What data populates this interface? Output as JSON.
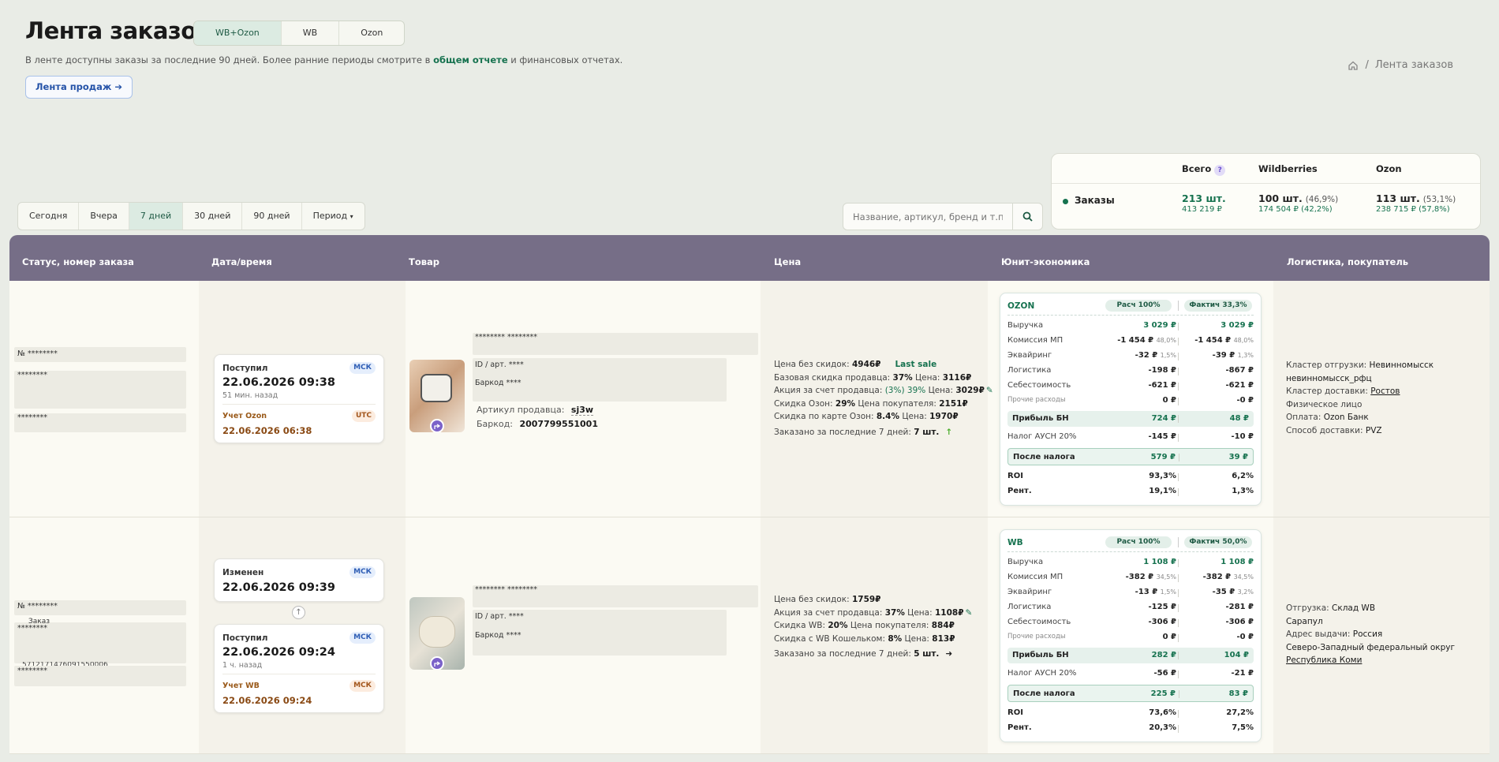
{
  "header": {
    "title": "Лента заказов",
    "seg": [
      "WB+Ozon",
      "WB",
      "Ozon"
    ],
    "sub_before": "В ленте доступны заказы за последние 90 дней. Более ранние периоды смотрите в ",
    "sub_link": "общем отчете",
    "sub_after": " и финансовых отчетах.",
    "sales_btn": "Лента продаж",
    "crumb_sep": "/",
    "crumb": "Лента заказов"
  },
  "summary": {
    "h_total": "Всего",
    "h_help": "?",
    "h_wb": "Wildberries",
    "h_ozon": "Ozon",
    "row": "Заказы",
    "total_cnt": "213 шт.",
    "total_sum": "413 219 ₽",
    "wb_cnt": "100 шт.",
    "wb_pct": "(46,9%)",
    "wb_sum": "174 504 ₽ (42,2%)",
    "ozon_cnt": "113 шт.",
    "ozon_pct": "(53,1%)",
    "ozon_sum": "238 715 ₽ (57,8%)"
  },
  "periods": [
    "Сегодня",
    "Вчера",
    "7 дней",
    "30 дней",
    "90 дней",
    "Период"
  ],
  "search": {
    "placeholder": "Название, артикул, бренд и т.п."
  },
  "columns": [
    "Статус, номер заказа",
    "Дата/время",
    "Товар",
    "Цена",
    "Юнит-экономика",
    "Логистика, покупатель"
  ],
  "orders": [
    {
      "num": "№ ********",
      "m1": "********",
      "m2": "********",
      "card1": {
        "label": "Поступил",
        "tz": "МСК",
        "date": "22.06.2026 09:38",
        "ago": "51 мин. назад",
        "acc_label": "Учет Ozon",
        "acc_tz": "UTC",
        "acc_date": "22.06.2026 06:38"
      },
      "prod": {
        "name": "******** ********",
        "id": "ID / арт. ****",
        "barcode": "Баркод ****",
        "seller_lbl": "Артикул продавца:",
        "seller_val": "sj3w",
        "bc_lbl": "Баркод:",
        "bc_val": "2007799551001"
      },
      "price": [
        [
          "Цена без скидок: ",
          "4946₽"
        ],
        [
          "Базовая скидка продавца: ",
          "37%",
          " Цена: ",
          "3116₽"
        ],
        [
          "Акция за счет продавца: ",
          "(3%) 39%",
          " Цена: ",
          "3029₽"
        ],
        [
          "Скидка Озон: ",
          "29%",
          " Цена покупателя: ",
          "2151₽"
        ],
        [
          "Скидка по карте Озон: ",
          "8.4%",
          " Цена: ",
          "1970₽"
        ],
        [
          "Заказано за последние 7 дней: ",
          "7 шт."
        ]
      ],
      "last_sale": "Last sale",
      "unit": {
        "mp": "OZON",
        "calc": "Расч 100%",
        "fact": "Фактич 33,3%",
        "rows": [
          [
            "Выручка",
            "3 029 ₽",
            "",
            "3 029 ₽",
            ""
          ],
          [
            "Комиссия МП",
            "-1 454 ₽",
            "48,0%",
            "-1 454 ₽",
            "48,0%"
          ],
          [
            "Эквайринг",
            "-32 ₽",
            "1,5%",
            "-39 ₽",
            "1,3%"
          ],
          [
            "Логистика",
            "-198 ₽",
            "",
            "-867 ₽",
            ""
          ],
          [
            "Себестоимость",
            "-621 ₽",
            "",
            "-621 ₽",
            ""
          ],
          [
            "Прочие расходы",
            "0 ₽",
            "",
            "-0 ₽",
            ""
          ]
        ],
        "profit": [
          "Прибыль БН",
          "724 ₽",
          "48 ₽"
        ],
        "tax": [
          "Налог АУСН 20%",
          "-145 ₽",
          "-10 ₽"
        ],
        "after": [
          "После налога",
          "579 ₽",
          "39 ₽"
        ],
        "roi": [
          "ROI",
          "93,3%",
          "6,2%"
        ],
        "rent": [
          "Рент.",
          "19,1%",
          "1,3%"
        ]
      },
      "log": [
        [
          "Кластер отгрузки: ",
          "Невинномысск"
        ],
        [
          "",
          "невинномысск_рфц"
        ],
        [
          "Кластер доставки: ",
          "Ростов"
        ],
        [
          "",
          "Физическое лицо"
        ],
        [
          "Оплата: ",
          "Ozon Банк"
        ],
        [
          "Способ доставки: ",
          "PVZ"
        ]
      ]
    },
    {
      "num": "№ ********",
      "m1": "********",
      "m2": "********",
      "ord_word": "Заказ",
      "ord_code": "5712171476091550006",
      "card0": {
        "label": "Изменен",
        "tz": "МСК",
        "date": "22.06.2026 09:39"
      },
      "card1": {
        "label": "Поступил",
        "tz": "МСК",
        "date": "22.06.2026 09:24",
        "ago": "1 ч. назад",
        "acc_label": "Учет WB",
        "acc_tz": "МСК",
        "acc_date": "22.06.2026 09:24"
      },
      "prod": {
        "name": "******** ********",
        "id": "ID / арт. ****",
        "barcode": "Баркод ****"
      },
      "price": [
        [
          "Цена без скидок: ",
          "1759₽"
        ],
        [
          "Акция за счет продавца: ",
          "37%",
          " Цена: ",
          "1108₽"
        ],
        [
          "Скидка WB: ",
          "20%",
          " Цена покупателя: ",
          "884₽"
        ],
        [
          "Скидка с WB Кошельком: ",
          "8%",
          " Цена: ",
          "813₽"
        ],
        [
          "Заказано за последние 7 дней: ",
          "5 шт."
        ]
      ],
      "unit": {
        "mp": "WB",
        "calc": "Расч 100%",
        "fact": "Фактич 50,0%",
        "rows": [
          [
            "Выручка",
            "1 108 ₽",
            "",
            "1 108 ₽",
            ""
          ],
          [
            "Комиссия МП",
            "-382 ₽",
            "34,5%",
            "-382 ₽",
            "34,5%"
          ],
          [
            "Эквайринг",
            "-13 ₽",
            "1,5%",
            "-35 ₽",
            "3,2%"
          ],
          [
            "Логистика",
            "-125 ₽",
            "",
            "-281 ₽",
            ""
          ],
          [
            "Себестоимость",
            "-306 ₽",
            "",
            "-306 ₽",
            ""
          ],
          [
            "Прочие расходы",
            "0 ₽",
            "",
            "-0 ₽",
            ""
          ]
        ],
        "profit": [
          "Прибыль БН",
          "282 ₽",
          "104 ₽"
        ],
        "tax": [
          "Налог АУСН 20%",
          "-56 ₽",
          "-21 ₽"
        ],
        "after": [
          "После налога",
          "225 ₽",
          "83 ₽"
        ],
        "roi": [
          "ROI",
          "73,6%",
          "27,2%"
        ],
        "rent": [
          "Рент.",
          "20,3%",
          "7,5%"
        ]
      },
      "log": [
        [
          "Отгрузка: ",
          "Склад WB"
        ],
        [
          "",
          "Сарапул"
        ],
        [
          "Адрес выдачи: ",
          "Россия"
        ],
        [
          "",
          "Северо-Западный федеральный округ"
        ],
        [
          "",
          "Республика Коми"
        ]
      ]
    }
  ]
}
